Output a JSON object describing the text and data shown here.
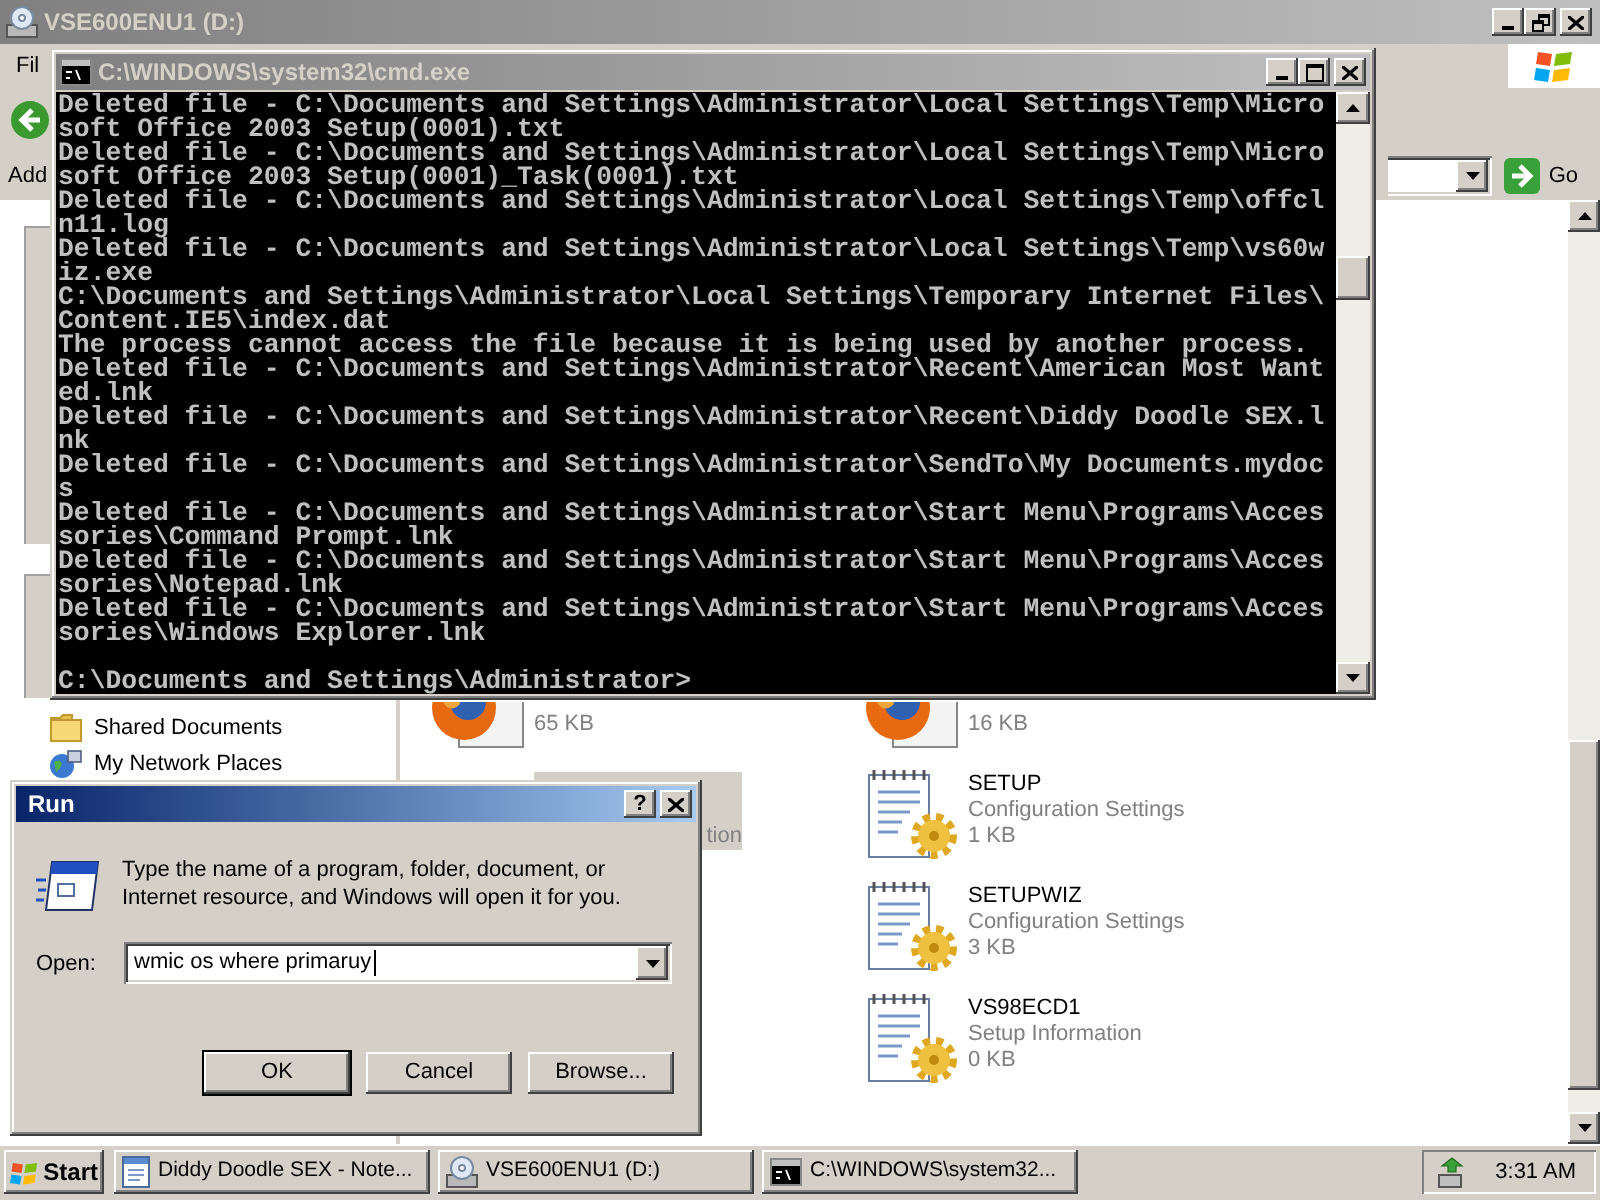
{
  "explorer": {
    "title": "VSE600ENU1 (D:)",
    "active": false,
    "menu": [
      {
        "label": "Fil"
      }
    ],
    "address_bar": {
      "label": "Add"
    },
    "go_button": "Go",
    "folder_tree": {
      "items": [
        {
          "kind": "folder",
          "label": "Shared Documents"
        },
        {
          "kind": "network",
          "label": "My Network Places"
        }
      ]
    },
    "files": {
      "column_1": [
        {
          "kind": "browser",
          "size": "65 KB",
          "selected": false
        },
        {
          "text": "tion",
          "selected": true
        }
      ],
      "column_2": [
        {
          "kind": "browser",
          "size": "16 KB",
          "selected": false
        },
        {
          "kind": "config",
          "name": "SETUP",
          "type": "Configuration Settings",
          "size": "1 KB",
          "selected": false
        },
        {
          "kind": "config",
          "name": "SETUPWIZ",
          "type": "Configuration Settings",
          "size": "3 KB",
          "selected": false
        },
        {
          "kind": "config",
          "name": "VS98ECD1",
          "type": "Setup Information",
          "size": "0 KB",
          "selected": false
        }
      ]
    }
  },
  "console": {
    "title": "C:\\WINDOWS\\system32\\cmd.exe",
    "active": false,
    "lines": [
      "Deleted file - C:\\Documents and Settings\\Administrator\\Local Settings\\Temp\\Micro",
      "soft Office 2003 Setup(0001).txt",
      "Deleted file - C:\\Documents and Settings\\Administrator\\Local Settings\\Temp\\Micro",
      "soft Office 2003 Setup(0001)_Task(0001).txt",
      "Deleted file - C:\\Documents and Settings\\Administrator\\Local Settings\\Temp\\offcl",
      "n11.log",
      "Deleted file - C:\\Documents and Settings\\Administrator\\Local Settings\\Temp\\vs60w",
      "iz.exe",
      "C:\\Documents and Settings\\Administrator\\Local Settings\\Temporary Internet Files\\",
      "Content.IE5\\index.dat",
      "The process cannot access the file because it is being used by another process.",
      "Deleted file - C:\\Documents and Settings\\Administrator\\Recent\\American Most Want",
      "ed.lnk",
      "Deleted file - C:\\Documents and Settings\\Administrator\\Recent\\Diddy Doodle SEX.l",
      "nk",
      "Deleted file - C:\\Documents and Settings\\Administrator\\SendTo\\My Documents.mydoc",
      "s",
      "Deleted file - C:\\Documents and Settings\\Administrator\\Start Menu\\Programs\\Acces",
      "sories\\Command Prompt.lnk",
      "Deleted file - C:\\Documents and Settings\\Administrator\\Start Menu\\Programs\\Acces",
      "sories\\Notepad.lnk",
      "Deleted file - C:\\Documents and Settings\\Administrator\\Start Menu\\Programs\\Acces",
      "sories\\Windows Explorer.lnk"
    ],
    "prompt": "C:\\Documents and Settings\\Administrator>"
  },
  "run_dialog": {
    "title": "Run",
    "active": true,
    "help_button": "?",
    "message": "Type the name of a program, folder, document, or Internet resource, and Windows will open it for you.",
    "open_label": "Open:",
    "value": "wmic os where primaruy",
    "buttons": [
      {
        "label": "OK",
        "default": true
      },
      {
        "label": "Cancel",
        "default": false
      },
      {
        "label": "Browse...",
        "default": false
      }
    ]
  },
  "taskbar": {
    "start": "Start",
    "tasks": [
      {
        "kind": "notepad",
        "label": "Diddy Doodle SEX - Note..."
      },
      {
        "kind": "drive",
        "label": "VSE600ENU1 (D:)"
      },
      {
        "kind": "console",
        "label": "C:\\WINDOWS\\system32..."
      }
    ],
    "clock": "3:31 AM"
  }
}
